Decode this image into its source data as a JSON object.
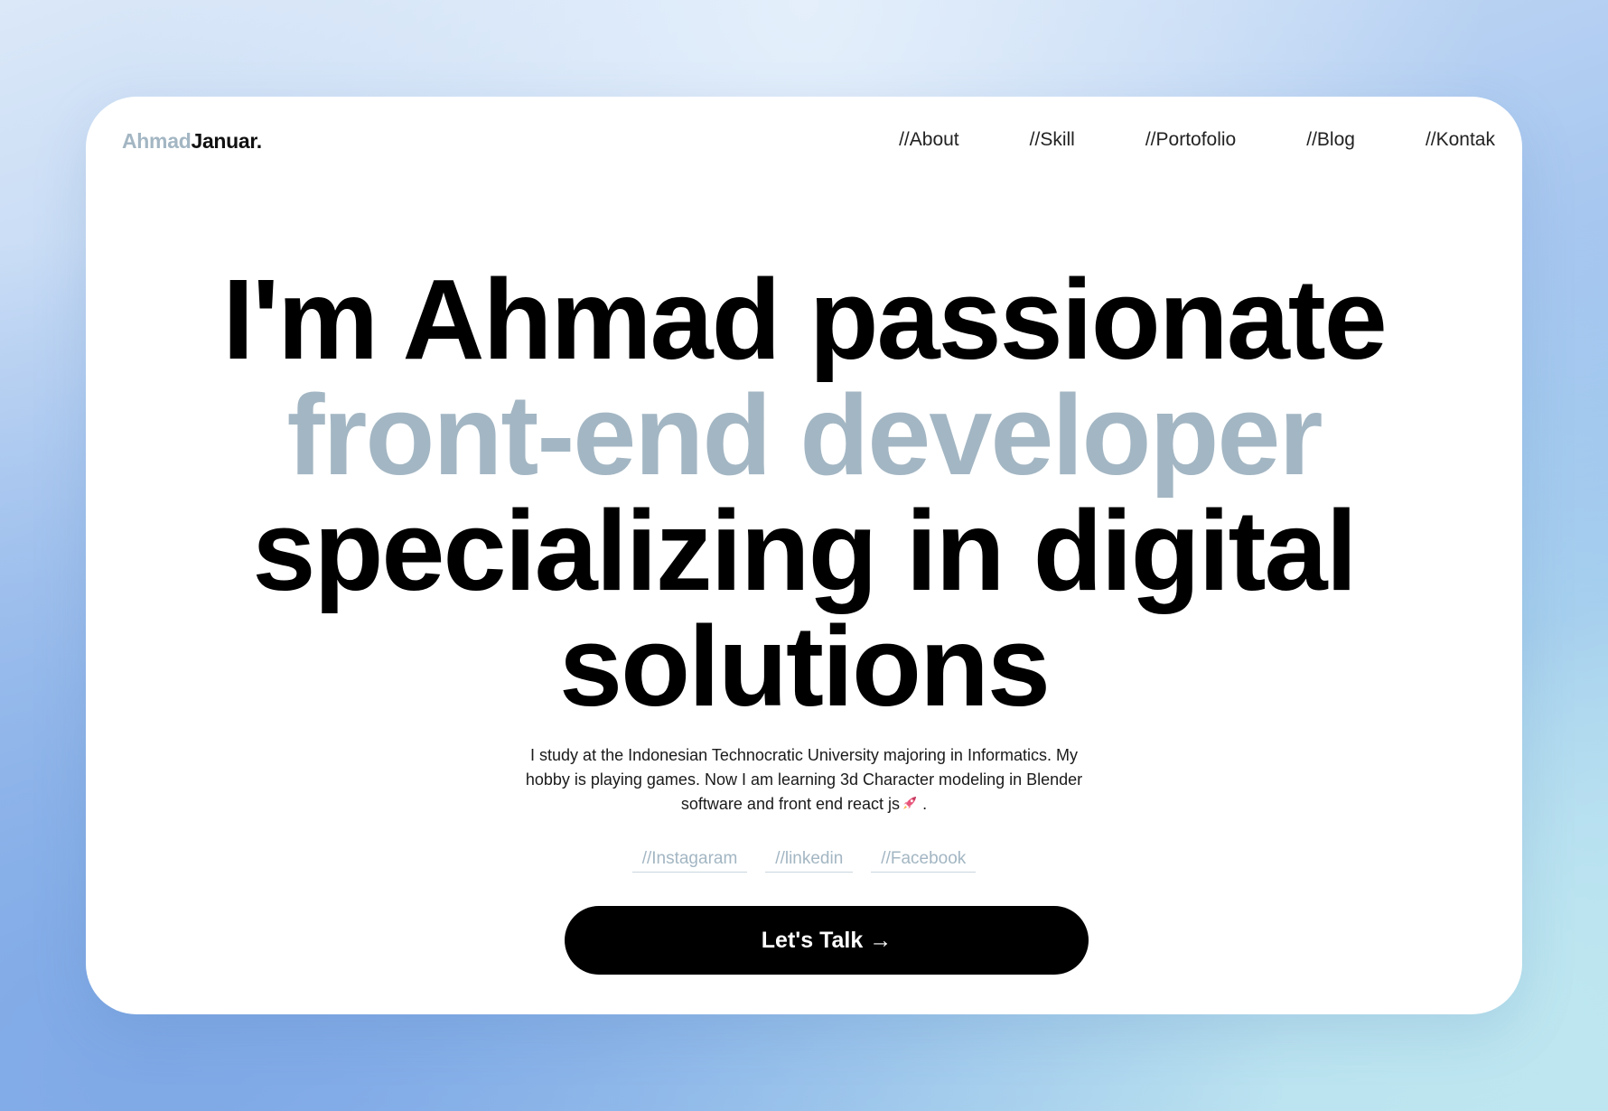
{
  "logo": {
    "first": "Ahmad",
    "last": "Januar."
  },
  "nav": {
    "items": [
      {
        "label": "//About"
      },
      {
        "label": "//Skill"
      },
      {
        "label": "//Portofolio"
      },
      {
        "label": "//Blog"
      },
      {
        "label": "//Kontak"
      }
    ]
  },
  "hero": {
    "line1": "I'm Ahmad passionate",
    "line2": "front-end developer",
    "line3": "specializing in digital",
    "line4": "solutions"
  },
  "bio": {
    "line1": "I study at the Indonesian Technocratic University majoring in Informatics. My",
    "line2": "hobby is playing games. Now I am learning 3d Character modeling in Blender",
    "line3": "software and front end react js",
    "line3_end": "."
  },
  "socials": [
    {
      "label": "//Instagaram"
    },
    {
      "label": "//linkedin"
    },
    {
      "label": "//Facebook"
    }
  ],
  "cta": {
    "label": "Let's Talk →"
  },
  "colors": {
    "accent": "#a3b6c3",
    "text": "#000000",
    "button_bg": "#000000",
    "button_text": "#ffffff",
    "card_bg": "#ffffff"
  },
  "icons": {
    "bio_emoji": "rocket-icon"
  }
}
